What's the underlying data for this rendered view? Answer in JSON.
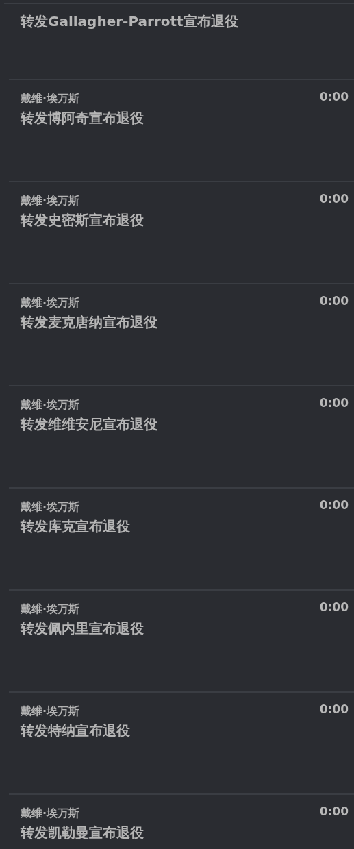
{
  "messages": [
    {
      "message": "转发Gallagher-Parrott宣布退役"
    },
    {
      "sender": "戴维·埃万斯",
      "time": "0:00",
      "message": "转发博阿奇宣布退役"
    },
    {
      "sender": "戴维·埃万斯",
      "time": "0:00",
      "message": "转发史密斯宣布退役"
    },
    {
      "sender": "戴维·埃万斯",
      "time": "0:00",
      "message": "转发麦克唐纳宣布退役"
    },
    {
      "sender": "戴维·埃万斯",
      "time": "0:00",
      "message": "转发维维安尼宣布退役"
    },
    {
      "sender": "戴维·埃万斯",
      "time": "0:00",
      "message": "转发库克宣布退役"
    },
    {
      "sender": "戴维·埃万斯",
      "time": "0:00",
      "message": "转发佩内里宣布退役"
    },
    {
      "sender": "戴维·埃万斯",
      "time": "0:00",
      "message": "转发特纳宣布退役"
    },
    {
      "sender": "戴维·埃万斯",
      "time": "0:00",
      "message": "转发凯勒曼宣布退役"
    }
  ]
}
